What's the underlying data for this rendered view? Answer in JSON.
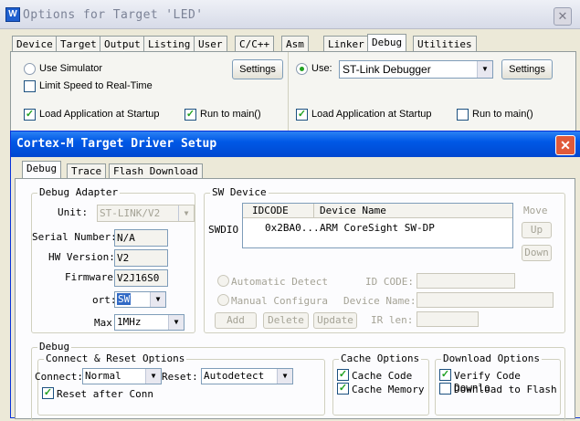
{
  "back_window": {
    "title": "Options for Target 'LED'",
    "icon_letter": "W",
    "close": "✕",
    "tabs": [
      "Device",
      "Target",
      "Output",
      "Listing",
      "User",
      "C/C++",
      "Asm",
      "Linker",
      "Debug",
      "Utilities"
    ],
    "active_tab": "Debug",
    "left": {
      "use_simulator": "Use Simulator",
      "limit_speed": "Limit Speed to Real-Time",
      "settings": "Settings",
      "load_app": "Load Application at Startup",
      "run_to_main": "Run to main()"
    },
    "right": {
      "use": "Use:",
      "debugger": "ST-Link Debugger",
      "settings": "Settings",
      "load_app": "Load Application at Startup",
      "run_to_main": "Run to main()"
    }
  },
  "dialog": {
    "title": "Cortex-M Target Driver Setup",
    "close": "✕",
    "tabs": [
      "Debug",
      "Trace",
      "Flash Download"
    ],
    "active_tab": "Debug",
    "debug_adapter": {
      "label": "Debug Adapter",
      "unit_label": "Unit:",
      "unit_value": "ST-LINK/V2",
      "serial_label": "Serial Number:",
      "serial_value": "N/A",
      "hw_label": "HW Version:",
      "hw_value": "V2",
      "fw_label": "Firmware",
      "fw_value": "V2J16S0",
      "port_label": "ort:",
      "port_value": "SW",
      "max_label": "Max",
      "max_value": "1MHz"
    },
    "sw_device": {
      "label": "SW Device",
      "swdio": "SWDIO",
      "col_idcode": "IDCODE",
      "col_name": "Device Name",
      "row_idcode": "0x2BA0...",
      "row_name": "ARM CoreSight SW-DP",
      "move": "Move",
      "up": "Up",
      "down": "Down",
      "auto": "Automatic Detecti",
      "manual": "Manual Configurati",
      "id_code": "ID CODE:",
      "device_name": "Device Name:",
      "ir_len": "IR len:",
      "add": "Add",
      "delete": "Delete",
      "update": "Update"
    },
    "debug_group": {
      "label": "Debug",
      "connect_reset": {
        "label": "Connect & Reset Options",
        "connect_label": "Connect:",
        "connect_value": "Normal",
        "reset_label": "Reset:",
        "reset_value": "Autodetect",
        "reset_after": "Reset after Conn"
      },
      "cache": {
        "label": "Cache Options",
        "cache_code": "Cache Code",
        "cache_memory": "Cache Memory"
      },
      "download": {
        "label": "Download Options",
        "verify": "Verify Code Downlo",
        "download_flash": "Download to Flash"
      }
    }
  }
}
